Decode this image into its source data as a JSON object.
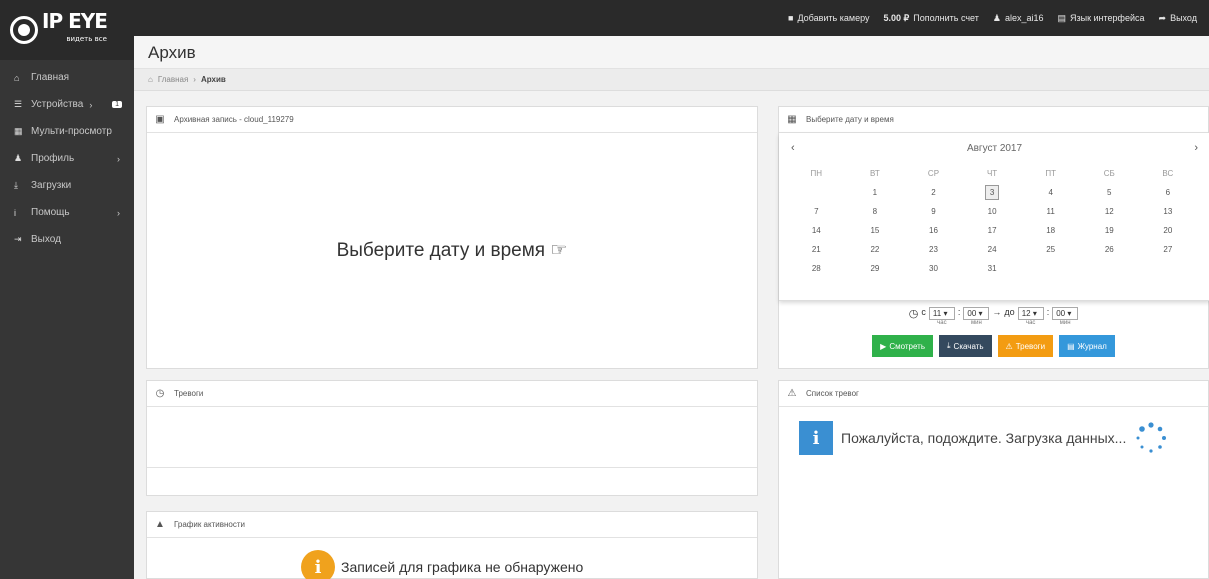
{
  "brand": {
    "name": "IP EYE",
    "tagline": "видеть все"
  },
  "topbar": {
    "add_camera": "Добавить камеру",
    "balance_amount": "5.00 ₽",
    "top_up": "Пополнить счет",
    "username": "alex_ai16",
    "language": "Язык интерфейса",
    "logout": "Выход"
  },
  "sidebar": {
    "items": [
      {
        "icon": "home-icon",
        "label": "Главная"
      },
      {
        "icon": "list-icon",
        "label": "Устройства",
        "badge": "1"
      },
      {
        "icon": "grid-icon",
        "label": "Мульти-просмотр"
      },
      {
        "icon": "user-icon",
        "label": "Профиль"
      },
      {
        "icon": "download-icon",
        "label": "Загрузки"
      },
      {
        "icon": "info-icon",
        "label": "Помощь"
      },
      {
        "icon": "signout-icon",
        "label": "Выход"
      }
    ]
  },
  "page": {
    "title": "Архив"
  },
  "breadcrumb": {
    "home": "Главная",
    "current": "Архив"
  },
  "archive_panel": {
    "title": "Архивная запись - cloud_119279",
    "message": "Выберите дату и время"
  },
  "calendar_panel": {
    "title": "Выберите дату и время",
    "month": "Август 2017",
    "weekdays": [
      "ПН",
      "ВТ",
      "СР",
      "ЧТ",
      "ПТ",
      "СБ",
      "ВС"
    ],
    "days": [
      "",
      "1",
      "2",
      "3",
      "4",
      "5",
      "6",
      "7",
      "8",
      "9",
      "10",
      "11",
      "12",
      "13",
      "14",
      "15",
      "16",
      "17",
      "18",
      "19",
      "20",
      "21",
      "22",
      "23",
      "24",
      "25",
      "26",
      "27",
      "28",
      "29",
      "30",
      "31",
      "",
      "",
      ""
    ],
    "today": "3",
    "time": {
      "from_label": "с",
      "from_hour": "11",
      "from_min": "00",
      "to_label": "до",
      "to_hour": "12",
      "to_min": "00",
      "hour_caption": "час",
      "min_caption": "мин"
    },
    "buttons": {
      "watch": "Смотреть",
      "download": "Скачать",
      "alarms": "Тревоги",
      "journal": "Журнал"
    },
    "colors": {
      "watch": "#2fb14a",
      "download": "#34495e",
      "alarms": "#f39c12",
      "journal": "#3498db"
    }
  },
  "alarms_panel": {
    "title": "Тревоги"
  },
  "alarm_list_panel": {
    "title": "Список тревог",
    "loading": "Пожалуйста, подождите. Загрузка данных..."
  },
  "activity_panel": {
    "title": "График активности",
    "empty": "Записей для графика не обнаружено"
  }
}
